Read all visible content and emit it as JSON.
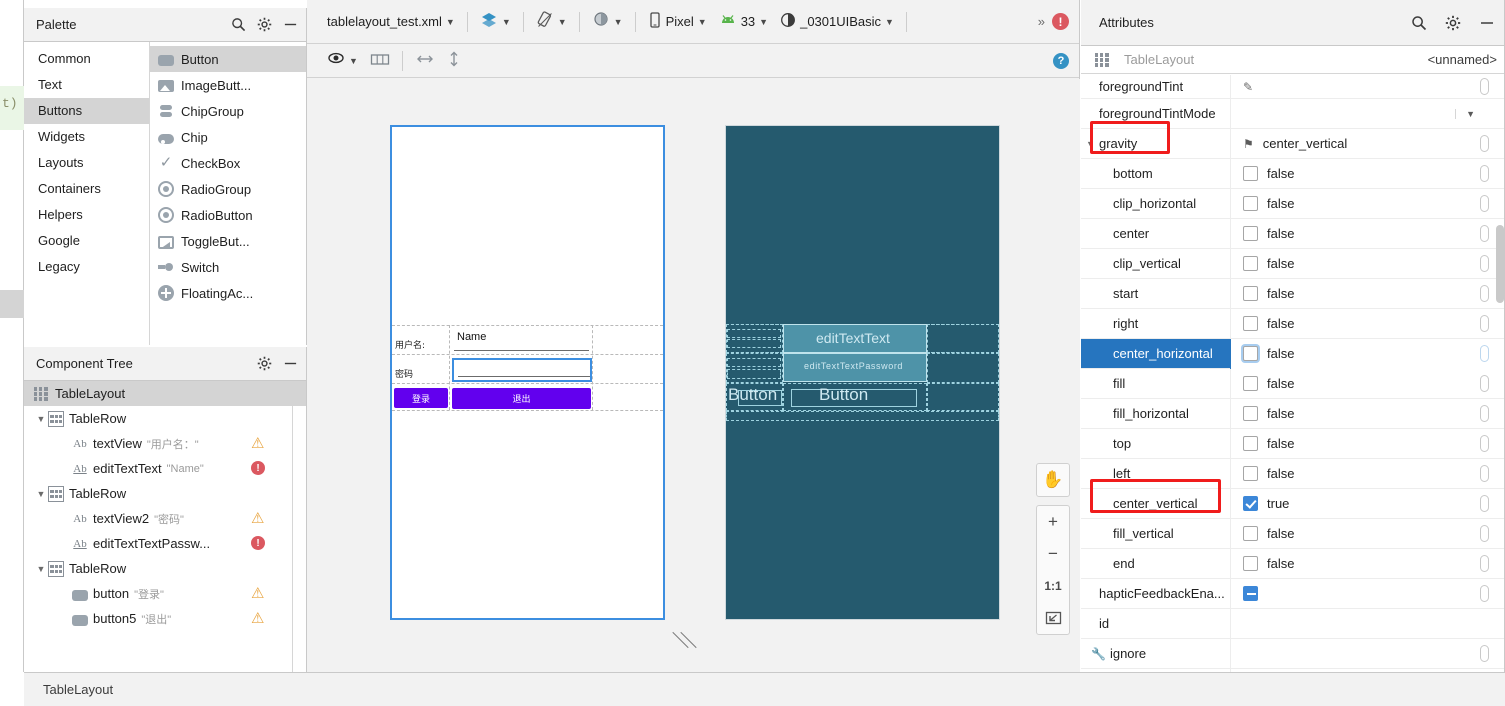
{
  "code_strip": {
    "fragment": "t)"
  },
  "palette": {
    "title": "Palette",
    "search_icon": "search-icon",
    "gear_icon": "gear-icon",
    "minimize_icon": "minimize-icon",
    "categories": [
      {
        "label": "Common",
        "selected": false
      },
      {
        "label": "Text",
        "selected": false
      },
      {
        "label": "Buttons",
        "selected": true
      },
      {
        "label": "Widgets",
        "selected": false
      },
      {
        "label": "Layouts",
        "selected": false
      },
      {
        "label": "Containers",
        "selected": false
      },
      {
        "label": "Helpers",
        "selected": false
      },
      {
        "label": "Google",
        "selected": false
      },
      {
        "label": "Legacy",
        "selected": false
      }
    ],
    "items": [
      {
        "label": "Button",
        "icon": "button-icon",
        "selected": true
      },
      {
        "label": "ImageButt...",
        "icon": "image-button-icon",
        "selected": false
      },
      {
        "label": "ChipGroup",
        "icon": "chip-group-icon",
        "selected": false
      },
      {
        "label": "Chip",
        "icon": "chip-icon",
        "selected": false
      },
      {
        "label": "CheckBox",
        "icon": "checkbox-icon",
        "selected": false
      },
      {
        "label": "RadioGroup",
        "icon": "radio-group-icon",
        "selected": false
      },
      {
        "label": "RadioButton",
        "icon": "radio-button-icon",
        "selected": false
      },
      {
        "label": "ToggleBut...",
        "icon": "toggle-button-icon",
        "selected": false
      },
      {
        "label": "Switch",
        "icon": "switch-icon",
        "selected": false
      },
      {
        "label": "FloatingAc...",
        "icon": "floating-action-button-icon",
        "selected": false
      }
    ]
  },
  "component_tree": {
    "title": "Component Tree",
    "gear_icon": "gear-icon",
    "minimize_icon": "minimize-icon",
    "rows": [
      {
        "name": "TableLayout",
        "value": "",
        "icon": "tablelayout-icon",
        "indent": 0,
        "chevron": "",
        "badge": "",
        "selected": true
      },
      {
        "name": "TableRow",
        "value": "",
        "icon": "tablerow-icon",
        "indent": 1,
        "chevron": "v",
        "badge": "",
        "selected": false
      },
      {
        "name": "textView",
        "value": "\"用户名：\"",
        "icon": "ab-icon",
        "indent": 2,
        "chevron": "",
        "badge": "warning",
        "selected": false
      },
      {
        "name": "editTextText",
        "value": "\"Name\"",
        "icon": "ab-underline-icon",
        "indent": 2,
        "chevron": "",
        "badge": "error",
        "selected": false
      },
      {
        "name": "TableRow",
        "value": "",
        "icon": "tablerow-icon",
        "indent": 1,
        "chevron": "v",
        "badge": "",
        "selected": false
      },
      {
        "name": "textView2",
        "value": "\"密码\"",
        "icon": "ab-icon",
        "indent": 2,
        "chevron": "",
        "badge": "warning",
        "selected": false
      },
      {
        "name": "editTextTextPassw...",
        "value": "",
        "icon": "ab-underline-icon",
        "indent": 2,
        "chevron": "",
        "badge": "error",
        "selected": false
      },
      {
        "name": "TableRow",
        "value": "",
        "icon": "tablerow-icon",
        "indent": 1,
        "chevron": "v",
        "badge": "",
        "selected": false
      },
      {
        "name": "button",
        "value": "\"登录\"",
        "icon": "button-icon",
        "indent": 2,
        "chevron": "",
        "badge": "warning",
        "selected": false
      },
      {
        "name": "button5",
        "value": "\"退出\"",
        "icon": "button-icon",
        "indent": 2,
        "chevron": "",
        "badge": "warning",
        "selected": false
      }
    ]
  },
  "editor": {
    "toolbar": {
      "file_name": "tablelayout_test.xml",
      "layers_icon": "layers-icon",
      "orientation_icon": "rotate-orientation-icon",
      "theme_icon": "day-night-theme-icon",
      "device_icon": "phone-icon",
      "device": "Pixel",
      "api_icon": "android-icon",
      "api_level": "33",
      "theme_select_icon": "theme-circle-icon",
      "theme_name": "_0301UIBasic",
      "overflow": "»",
      "error_badge": "!"
    },
    "viewbar": {
      "eye_icon": "visibility-eye-icon",
      "columns_icon": "view-mode-columns-icon",
      "horizontal_icon": "horizontal-resize-icon",
      "vertical_icon": "vertical-resize-icon",
      "help_badge": "?"
    },
    "zoom_tools": {
      "pan_icon": "pan-hand-icon",
      "zoom_in": "+",
      "zoom_out": "−",
      "actual_size": "1:1",
      "fit_icon": "zoom-to-fit-icon"
    },
    "design_preview": {
      "username_label": "用户名:",
      "password_label": "密码",
      "name_field_text": "Name",
      "password_field_text": "",
      "login_button": "登录",
      "exit_button": "退出",
      "accent_color": "#6200ee",
      "selection_color": "#3c8ee0"
    },
    "blueprint_preview": {
      "background_color": "#255a6e",
      "edit_text_text": "editTextText",
      "edit_text_password": "editTextTextPassword",
      "button_left": "Button",
      "button_right": "Button"
    }
  },
  "attributes": {
    "title": "Attributes",
    "search_icon": "search-icon",
    "gear_icon": "gear-icon",
    "minimize_icon": "minimize-icon",
    "component_icon": "tablelayout-icon",
    "component_type": "TableLayout",
    "component_id": "<unnamed>",
    "rows": [
      {
        "key": "foregroundTint",
        "value": "",
        "type": "pencil",
        "indent": false,
        "selected": false,
        "highlight": false,
        "chevron": "",
        "partial": true
      },
      {
        "key": "foregroundTintMode",
        "value": "",
        "type": "dropdown",
        "indent": false,
        "selected": false,
        "highlight": false,
        "chevron": ""
      },
      {
        "key": "gravity",
        "value": "center_vertical",
        "type": "flag",
        "indent": false,
        "selected": false,
        "highlight": true,
        "chevron": "v"
      },
      {
        "key": "bottom",
        "value": "false",
        "type": "checkbox",
        "checked": false,
        "indent": true,
        "selected": false,
        "highlight": false,
        "chevron": ""
      },
      {
        "key": "clip_horizontal",
        "value": "false",
        "type": "checkbox",
        "checked": false,
        "indent": true,
        "selected": false,
        "highlight": false,
        "chevron": ""
      },
      {
        "key": "center",
        "value": "false",
        "type": "checkbox",
        "checked": false,
        "indent": true,
        "selected": false,
        "highlight": false,
        "chevron": ""
      },
      {
        "key": "clip_vertical",
        "value": "false",
        "type": "checkbox",
        "checked": false,
        "indent": true,
        "selected": false,
        "highlight": false,
        "chevron": ""
      },
      {
        "key": "start",
        "value": "false",
        "type": "checkbox",
        "checked": false,
        "indent": true,
        "selected": false,
        "highlight": false,
        "chevron": ""
      },
      {
        "key": "right",
        "value": "false",
        "type": "checkbox",
        "checked": false,
        "indent": true,
        "selected": false,
        "highlight": false,
        "chevron": ""
      },
      {
        "key": "center_horizontal",
        "value": "false",
        "type": "checkbox",
        "checked": false,
        "indent": true,
        "selected": true,
        "highlight": false,
        "chevron": "",
        "focused": true
      },
      {
        "key": "fill",
        "value": "false",
        "type": "checkbox",
        "checked": false,
        "indent": true,
        "selected": false,
        "highlight": false,
        "chevron": ""
      },
      {
        "key": "fill_horizontal",
        "value": "false",
        "type": "checkbox",
        "checked": false,
        "indent": true,
        "selected": false,
        "highlight": false,
        "chevron": ""
      },
      {
        "key": "top",
        "value": "false",
        "type": "checkbox",
        "checked": false,
        "indent": true,
        "selected": false,
        "highlight": false,
        "chevron": ""
      },
      {
        "key": "left",
        "value": "false",
        "type": "checkbox",
        "checked": false,
        "indent": true,
        "selected": false,
        "highlight": false,
        "chevron": ""
      },
      {
        "key": "center_vertical",
        "value": "true",
        "type": "checkbox",
        "checked": true,
        "indent": true,
        "selected": false,
        "highlight": true,
        "chevron": ""
      },
      {
        "key": "fill_vertical",
        "value": "false",
        "type": "checkbox",
        "checked": false,
        "indent": true,
        "selected": false,
        "highlight": false,
        "chevron": ""
      },
      {
        "key": "end",
        "value": "false",
        "type": "checkbox",
        "checked": false,
        "indent": true,
        "selected": false,
        "highlight": false,
        "chevron": ""
      },
      {
        "key": "hapticFeedbackEna...",
        "value": "",
        "type": "tristate",
        "indent": false,
        "selected": false,
        "highlight": false,
        "chevron": ""
      },
      {
        "key": "id",
        "value": "",
        "type": "text",
        "indent": false,
        "selected": false,
        "highlight": false,
        "chevron": "",
        "no_pill": true
      },
      {
        "key": "ignore",
        "value": "",
        "type": "wrench",
        "indent": false,
        "selected": false,
        "highlight": false,
        "chevron": ""
      }
    ]
  },
  "statusbar": {
    "text": "TableLayout"
  }
}
